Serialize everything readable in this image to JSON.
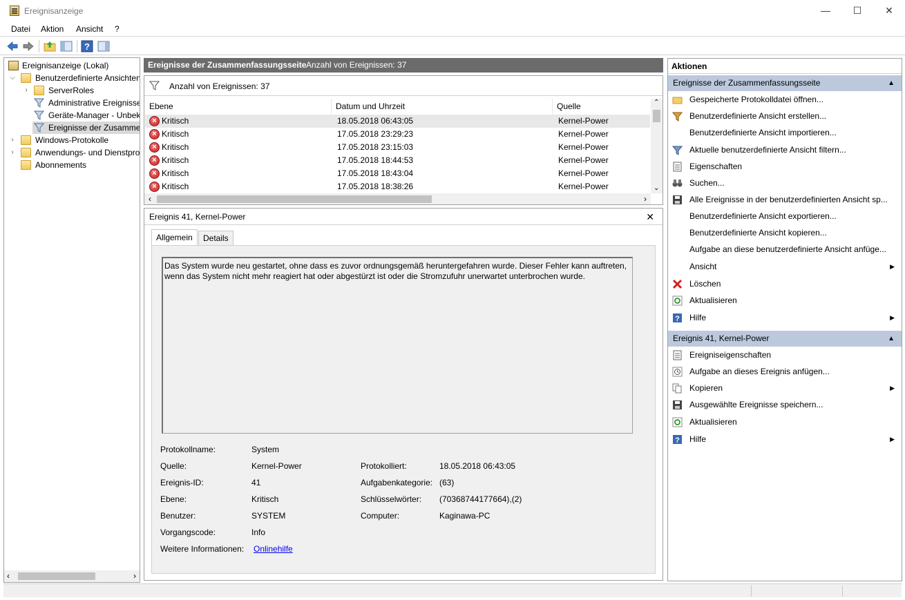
{
  "window": {
    "title": "Ereignisanzeige",
    "minimize": "—",
    "maximize": "☐",
    "close": "✕"
  },
  "menu": {
    "items": [
      "Datei",
      "Aktion",
      "Ansicht",
      "?"
    ]
  },
  "tree": {
    "items": [
      {
        "label": "Ereignisanzeige (Lokal)"
      },
      {
        "label": "Benutzerdefinierte Ansichten"
      },
      {
        "label": "ServerRoles"
      },
      {
        "label": "Administrative Ereignisse"
      },
      {
        "label": "Geräte-Manager - Unbek"
      },
      {
        "label": "Ereignisse der Zusammen"
      },
      {
        "label": "Windows-Protokolle"
      },
      {
        "label": "Anwendungs- und Dienstpro"
      },
      {
        "label": "Abonnements"
      }
    ]
  },
  "center": {
    "title": "Ereignisse der Zusammenfassungsseite",
    "count_label": "Anzahl von Ereignissen: 37",
    "filter_label": "Anzahl von Ereignissen: 37",
    "columns": [
      "Ebene",
      "Datum und Uhrzeit",
      "Quelle"
    ],
    "rows": [
      {
        "level": "Kritisch",
        "datetime": "18.05.2018 06:43:05",
        "source": "Kernel-Power"
      },
      {
        "level": "Kritisch",
        "datetime": "17.05.2018 23:29:23",
        "source": "Kernel-Power"
      },
      {
        "level": "Kritisch",
        "datetime": "17.05.2018 23:15:03",
        "source": "Kernel-Power"
      },
      {
        "level": "Kritisch",
        "datetime": "17.05.2018 18:44:53",
        "source": "Kernel-Power"
      },
      {
        "level": "Kritisch",
        "datetime": "17.05.2018 18:43:04",
        "source": "Kernel-Power"
      },
      {
        "level": "Kritisch",
        "datetime": "17.05.2018 18:38:26",
        "source": "Kernel-Power"
      }
    ]
  },
  "detail": {
    "title": "Ereignis 41, Kernel-Power",
    "tabs": [
      "Allgemein",
      "Details"
    ],
    "description": "Das System wurde neu gestartet, ohne dass es zuvor ordnungsgemäß heruntergefahren wurde. Dieser Fehler kann auftreten, wenn das System nicht mehr reagiert hat oder abgestürzt ist oder die Stromzufuhr unerwartet unterbrochen wurde.",
    "props": {
      "protokollname_label": "Protokollname:",
      "protokollname": "System",
      "quelle_label": "Quelle:",
      "quelle": "Kernel-Power",
      "protokolliert_label": "Protokolliert:",
      "protokolliert": "18.05.2018 06:43:05",
      "ereignis_id_label": "Ereignis-ID:",
      "ereignis_id": "41",
      "aufgabenkategorie_label": "Aufgabenkategorie:",
      "aufgabenkategorie": "(63)",
      "ebene_label": "Ebene:",
      "ebene": "Kritisch",
      "schluesselwoerter_label": "Schlüsselwörter:",
      "schluesselwoerter": "(70368744177664),(2)",
      "benutzer_label": "Benutzer:",
      "benutzer": "SYSTEM",
      "computer_label": "Computer:",
      "computer": "Kaginawa-PC",
      "vorgangscode_label": "Vorgangscode:",
      "vorgangscode": "Info",
      "weitere_label": "Weitere Informationen:",
      "weitere_link": "Onlinehilfe"
    }
  },
  "actions": {
    "header": "Aktionen",
    "section1": {
      "title": "Ereignisse der Zusammenfassungsseite",
      "items": [
        "Gespeicherte Protokolldatei öffnen...",
        "Benutzerdefinierte Ansicht erstellen...",
        "Benutzerdefinierte Ansicht importieren...",
        "Aktuelle benutzerdefinierte Ansicht filtern...",
        "Eigenschaften",
        "Suchen...",
        "Alle Ereignisse in der benutzerdefinierten Ansicht sp...",
        "Benutzerdefinierte Ansicht exportieren...",
        "Benutzerdefinierte Ansicht kopieren...",
        "Aufgabe an diese benutzerdefinierte Ansicht anfüge...",
        "Ansicht",
        "Löschen",
        "Aktualisieren",
        "Hilfe"
      ]
    },
    "section2": {
      "title": "Ereignis 41, Kernel-Power",
      "items": [
        "Ereigniseigenschaften",
        "Aufgabe an dieses Ereignis anfügen...",
        "Kopieren",
        "Ausgewählte Ereignisse speichern...",
        "Aktualisieren",
        "Hilfe"
      ]
    }
  },
  "colors": {
    "section_header": "#bcc9dd",
    "center_header": "#6b6b6b",
    "critical_red": "#c62020",
    "link_blue": "#0000ee"
  }
}
